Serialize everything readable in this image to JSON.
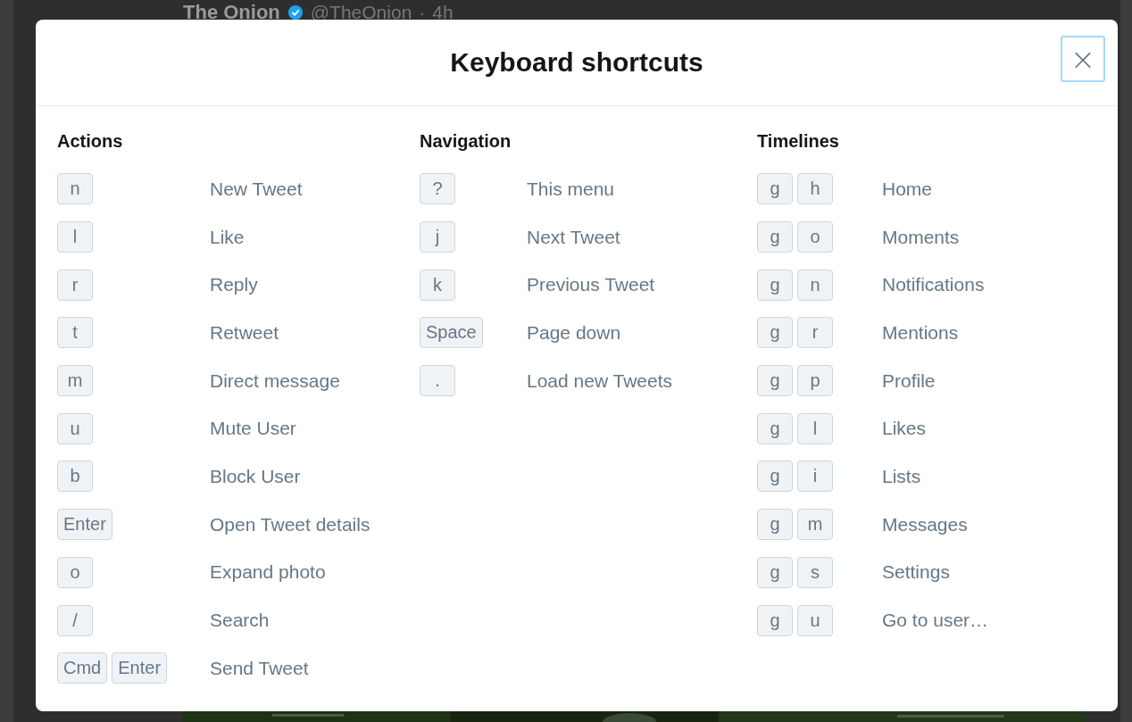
{
  "background_tweet": {
    "author": "The Onion",
    "handle": "@TheOnion",
    "separator": "·",
    "time": "4h"
  },
  "dialog": {
    "title": "Keyboard shortcuts",
    "close_label": "×"
  },
  "sections": [
    {
      "title": "Actions",
      "shortcuts": [
        {
          "keys": [
            "n"
          ],
          "description": "New Tweet"
        },
        {
          "keys": [
            "l"
          ],
          "description": "Like"
        },
        {
          "keys": [
            "r"
          ],
          "description": "Reply"
        },
        {
          "keys": [
            "t"
          ],
          "description": "Retweet"
        },
        {
          "keys": [
            "m"
          ],
          "description": "Direct message"
        },
        {
          "keys": [
            "u"
          ],
          "description": "Mute User"
        },
        {
          "keys": [
            "b"
          ],
          "description": "Block User"
        },
        {
          "keys": [
            "Enter"
          ],
          "description": "Open Tweet details"
        },
        {
          "keys": [
            "o"
          ],
          "description": "Expand photo"
        },
        {
          "keys": [
            "/"
          ],
          "description": "Search"
        },
        {
          "keys": [
            "Cmd",
            "Enter"
          ],
          "description": "Send Tweet"
        }
      ]
    },
    {
      "title": "Navigation",
      "shortcuts": [
        {
          "keys": [
            "?"
          ],
          "description": "This menu"
        },
        {
          "keys": [
            "j"
          ],
          "description": "Next Tweet"
        },
        {
          "keys": [
            "k"
          ],
          "description": "Previous Tweet"
        },
        {
          "keys": [
            "Space"
          ],
          "description": "Page down"
        },
        {
          "keys": [
            "."
          ],
          "description": "Load new Tweets"
        }
      ]
    },
    {
      "title": "Timelines",
      "shortcuts": [
        {
          "keys": [
            "g",
            "h"
          ],
          "description": "Home"
        },
        {
          "keys": [
            "g",
            "o"
          ],
          "description": "Moments"
        },
        {
          "keys": [
            "g",
            "n"
          ],
          "description": "Notifications"
        },
        {
          "keys": [
            "g",
            "r"
          ],
          "description": "Mentions"
        },
        {
          "keys": [
            "g",
            "p"
          ],
          "description": "Profile"
        },
        {
          "keys": [
            "g",
            "l"
          ],
          "description": "Likes"
        },
        {
          "keys": [
            "g",
            "i"
          ],
          "description": "Lists"
        },
        {
          "keys": [
            "g",
            "m"
          ],
          "description": "Messages"
        },
        {
          "keys": [
            "g",
            "s"
          ],
          "description": "Settings"
        },
        {
          "keys": [
            "g",
            "u"
          ],
          "description": "Go to user…"
        }
      ]
    }
  ]
}
